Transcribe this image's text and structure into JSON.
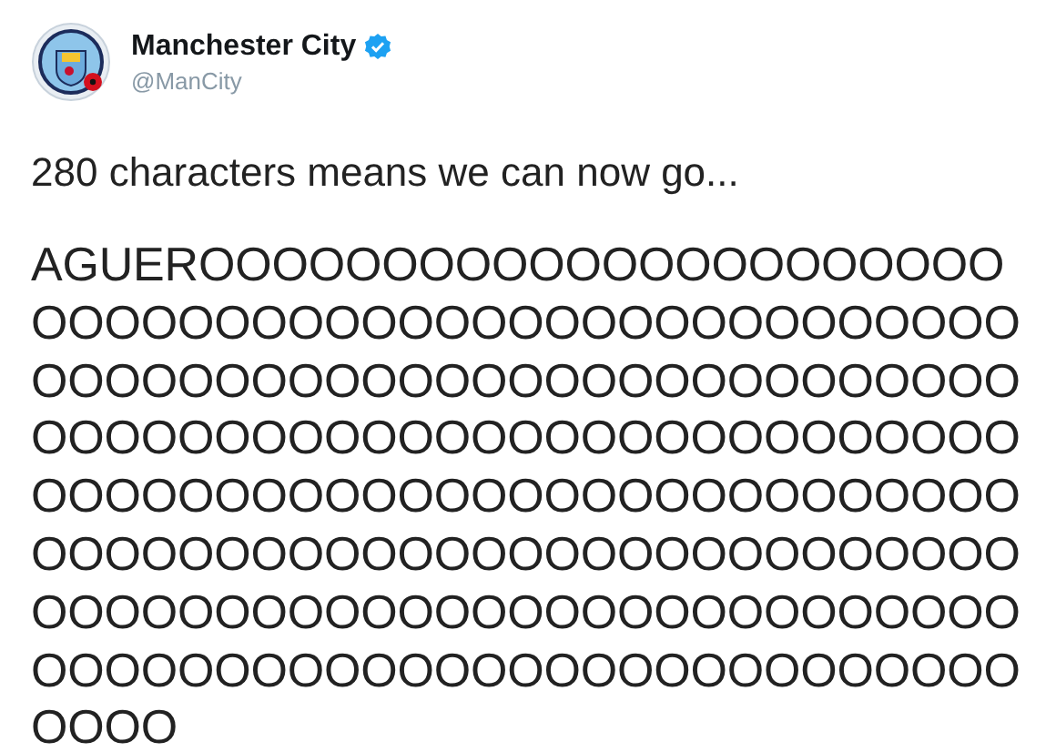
{
  "account": {
    "name": "Manchester City",
    "verified": true,
    "handle": "@ManCity"
  },
  "tweet": {
    "intro": "280 characters means we can now go...",
    "lines": [
      "AGUEROOOOOOOOOOOOOOOOOOOOOO",
      "OOOOOOOOOOOOOOOOOOOOOOOOOOO",
      "OOOOOOOOOOOOOOOOOOOOOOOOOOO",
      "OOOOOOOOOOOOOOOOOOOOOOOOOOO",
      "OOOOOOOOOOOOOOOOOOOOOOOOOOO",
      "OOOOOOOOOOOOOOOOOOOOOOOOOOO",
      "OOOOOOOOOOOOOOOOOOOOOOOOOOO",
      "OOOOOOOOOOOOOOOOOOOOOOOOOOO",
      "OOOO"
    ]
  }
}
